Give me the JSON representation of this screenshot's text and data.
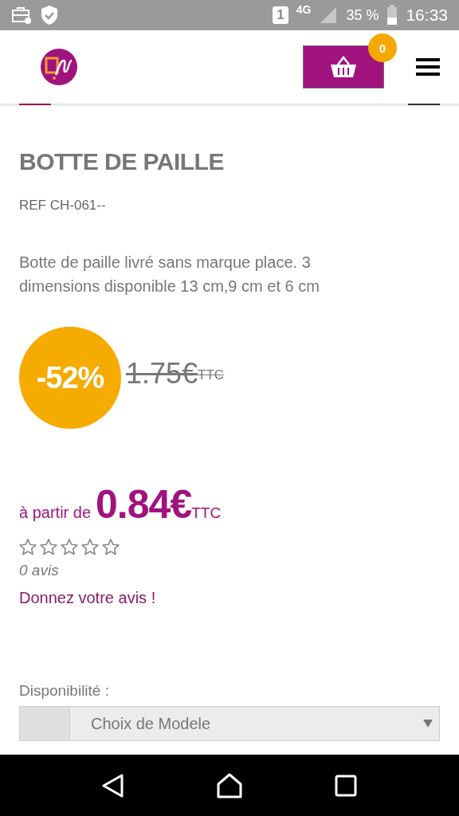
{
  "status_bar": {
    "sim": "1",
    "network": "4G",
    "battery": "35 %",
    "time": "16:33"
  },
  "header": {
    "cart_count": "0"
  },
  "product": {
    "title": "BOTTE DE PAILLE",
    "reference": "REF CH-061--",
    "description": "Botte de paille livré sans marque place. 3 dimensions disponible 13 cm,9 cm et 6 cm",
    "discount": "-52%",
    "old_price": "1.75€",
    "old_price_suffix": "TTC",
    "price_prefix": "à partir de",
    "price": "0.84€",
    "price_suffix": "TTC",
    "stars": 0,
    "review_count": "0 avis",
    "review_link": "Donnez votre avis !",
    "availability_label": "Disponibilité :",
    "model_select": {
      "value": "Choix de Modele"
    }
  }
}
